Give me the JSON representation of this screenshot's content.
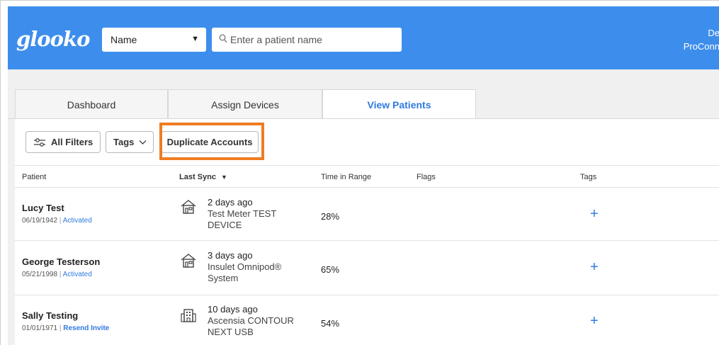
{
  "header": {
    "logo": "glooko",
    "search_type": "Name",
    "search_placeholder": "Enter a patient name",
    "user_name": "De",
    "user_org": "ProConn"
  },
  "tabs": [
    {
      "label": "Dashboard",
      "active": false
    },
    {
      "label": "Assign Devices",
      "active": false
    },
    {
      "label": "View Patients",
      "active": true
    }
  ],
  "filters": {
    "all_filters": "All Filters",
    "tags": "Tags",
    "duplicate_accounts": "Duplicate Accounts"
  },
  "table": {
    "columns": {
      "patient": "Patient",
      "last_sync": "Last Sync",
      "time_in_range": "Time in Range",
      "flags": "Flags",
      "tags": "Tags"
    },
    "rows": [
      {
        "name": "Lucy Test",
        "dob": "06/19/1942",
        "status": "Activated",
        "sync_time": "2 days ago",
        "device_line1": "Test Meter TEST",
        "device_line2": "DEVICE",
        "sync_icon": "home-icon",
        "time_in_range": "28%"
      },
      {
        "name": "George Testerson",
        "dob": "05/21/1998",
        "status": "Activated",
        "sync_time": "3 days ago",
        "device_line1": "Insulet Omnipod®",
        "device_line2": "System",
        "sync_icon": "home-icon",
        "time_in_range": "65%"
      },
      {
        "name": "Sally Testing",
        "dob": "01/01/1971",
        "status": "Resend Invite",
        "sync_time": "10 days ago",
        "device_line1": "Ascensia CONTOUR",
        "device_line2": "NEXT USB",
        "sync_icon": "clinic-building-icon",
        "time_in_range": "54%"
      }
    ],
    "add_tag_symbol": "+"
  },
  "colors": {
    "brand_blue": "#3d8eec",
    "link_blue": "#2f7ae0",
    "highlight_orange": "#ef7d22"
  }
}
